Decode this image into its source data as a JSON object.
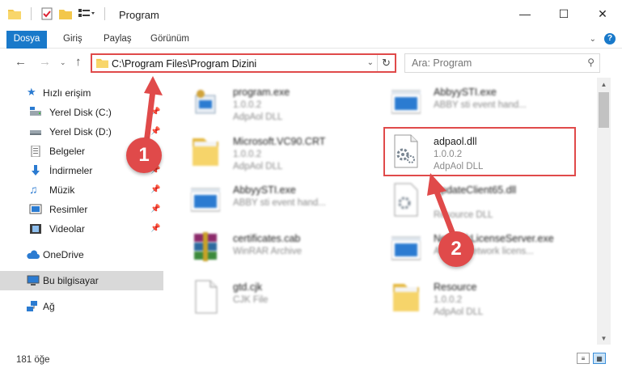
{
  "window": {
    "title": "Program",
    "minimize_icon": "minimize-icon",
    "maximize_icon": "maximize-icon",
    "close_icon": "close-icon"
  },
  "ribbon": {
    "tabs": [
      "Dosya",
      "Giriş",
      "Paylaş",
      "Görünüm"
    ],
    "file_tab_color": "#1979ca"
  },
  "address": {
    "path": "C:\\Program Files\\Program Dizini",
    "search_placeholder": "Ara: Program"
  },
  "sidebar": {
    "items": [
      {
        "label": "Hızlı erişim",
        "icon": "star-icon"
      },
      {
        "label": "Yerel Disk (C:)",
        "icon": "drive-icon",
        "pinned": true
      },
      {
        "label": "Yerel Disk (D:)",
        "icon": "drive-icon",
        "pinned": true
      },
      {
        "label": "Belgeler",
        "icon": "documents-icon",
        "pinned": true
      },
      {
        "label": "İndirmeler",
        "icon": "download-icon",
        "pinned": true
      },
      {
        "label": "Müzik",
        "icon": "music-icon",
        "pinned": true
      },
      {
        "label": "Resimler",
        "icon": "pictures-icon",
        "pinned": true
      },
      {
        "label": "Videolar",
        "icon": "videos-icon",
        "pinned": true
      },
      {
        "label": "OneDrive",
        "icon": "cloud-icon"
      },
      {
        "label": "Bu bilgisayar",
        "icon": "computer-icon",
        "selected": true
      },
      {
        "label": "Ağ",
        "icon": "network-icon"
      }
    ]
  },
  "files": [
    {
      "name": "program.exe",
      "line1": "1.0.0.2",
      "line2": "AdpAol DLL",
      "icon": "exe-icon"
    },
    {
      "name": "AbbyySTI.exe",
      "line1": "ABBY sti event hand...",
      "line2": "",
      "icon": "app-window-icon"
    },
    {
      "name": "Microsoft.VC90.CRT",
      "line1": "1.0.0.2",
      "line2": "AdpAol DLL",
      "icon": "folder-icon"
    },
    {
      "name": "adpaol.dll",
      "line1": "1.0.0.2",
      "line2": "AdpAol DLL",
      "icon": "dll-gear-icon"
    },
    {
      "name": "AbbyySTI.exe",
      "line1": "ABBY sti event hand...",
      "line2": "",
      "icon": "app-window-icon"
    },
    {
      "name": "UpdateClient65.dll",
      "line1": "",
      "line2": "Resource DLL",
      "icon": "dll-gear-icon"
    },
    {
      "name": "certificates.cab",
      "line1": "WinRAR Archive",
      "line2": "",
      "icon": "rar-icon"
    },
    {
      "name": "NetworkLicenseServer.exe",
      "line1": "ABBYY network licens...",
      "line2": "",
      "icon": "app-window-icon"
    },
    {
      "name": "gtd.cjk",
      "line1": "CJK File",
      "line2": "",
      "icon": "blank-file-icon"
    },
    {
      "name": "Resource",
      "line1": "1.0.0.2",
      "line2": "AdpAol DLL",
      "icon": "folder-icon"
    }
  ],
  "status": {
    "item_count": "181 öğe"
  },
  "annotations": [
    {
      "number": "1",
      "target": "address-bar"
    },
    {
      "number": "2",
      "target": "adpaol.dll"
    }
  ],
  "colors": {
    "annotation": "#e04a4a",
    "selection": "#d9d9d9"
  }
}
